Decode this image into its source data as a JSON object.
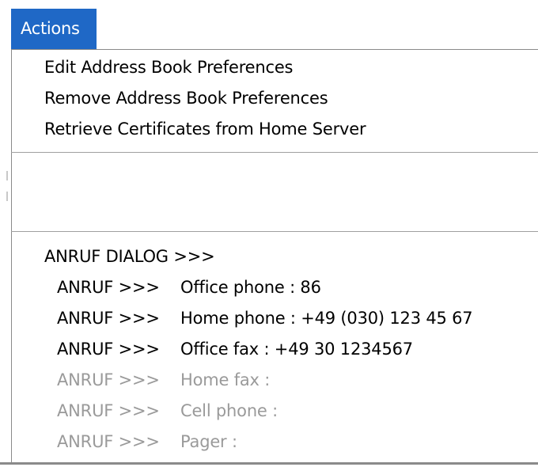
{
  "menubar": {
    "title": "Actions"
  },
  "menu": {
    "items": [
      {
        "label": "Edit Address Book Preferences",
        "enabled": true
      },
      {
        "label": "Remove Address Book Preferences",
        "enabled": true
      },
      {
        "label": "Retrieve Certificates from Home Server",
        "enabled": true
      }
    ],
    "call_dialog": {
      "label": "ANRUF DIALOG  >>>",
      "prefix": "ANRUF >>>",
      "entries": [
        {
          "label": "Office phone : 86",
          "enabled": true
        },
        {
          "label": "Home phone : +49 (030) 123 45 67",
          "enabled": true
        },
        {
          "label": "Office fax : +49 30 1234567",
          "enabled": true
        },
        {
          "label": "Home fax :",
          "enabled": false
        },
        {
          "label": "Cell phone :",
          "enabled": false
        },
        {
          "label": "Pager :",
          "enabled": false
        }
      ]
    }
  },
  "colors": {
    "menu_highlight": "#1f68c6",
    "disabled_text": "#9a9a9a",
    "separator": "#a0a0a0"
  }
}
